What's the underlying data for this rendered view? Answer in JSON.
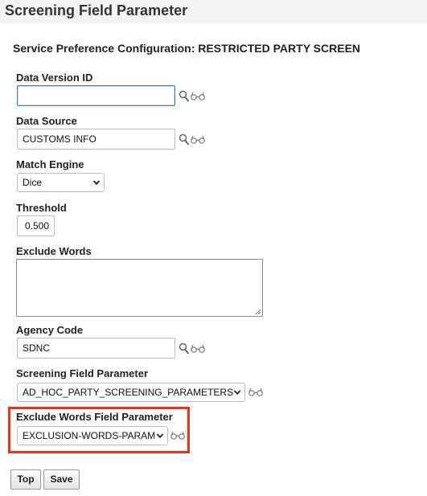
{
  "page": {
    "title": "Screening Field Parameter"
  },
  "form": {
    "section_title": "Service Preference Configuration: RESTRICTED PARTY SCREEN",
    "data_version_id": {
      "label": "Data Version ID",
      "value": ""
    },
    "data_source": {
      "label": "Data Source",
      "value": "CUSTOMS INFO"
    },
    "match_engine": {
      "label": "Match Engine",
      "value": "Dice"
    },
    "threshold": {
      "label": "Threshold",
      "value": "0.500"
    },
    "exclude_words": {
      "label": "Exclude Words",
      "value": ""
    },
    "agency_code": {
      "label": "Agency Code",
      "value": "SDNC"
    },
    "screening_field_parameter": {
      "label": "Screening Field Parameter",
      "value": "AD_HOC_PARTY_SCREENING_PARAMETERS"
    },
    "exclude_words_field_parameter": {
      "label": "Exclude Words Field Parameter",
      "value": "EXCLUSION-WORDS-PARAM"
    }
  },
  "icons": {
    "search": "search-icon",
    "details": "glasses-icon",
    "dropdown": "chevron-down-icon"
  },
  "buttons": {
    "top": "Top",
    "save": "Save"
  },
  "colors": {
    "highlight": "#f0311a",
    "focus_border": "#4a7db8"
  }
}
